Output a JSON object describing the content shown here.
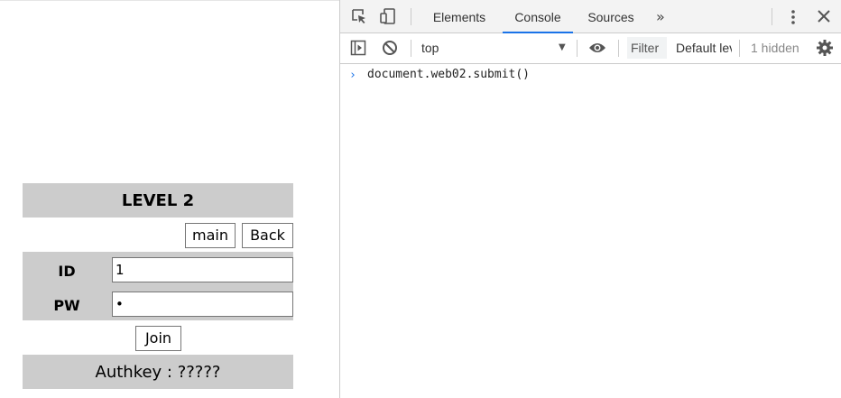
{
  "page": {
    "title": "LEVEL 2",
    "main_button": "main",
    "back_button": "Back",
    "id_label": "ID",
    "id_value": "1",
    "pw_label": "PW",
    "pw_value": "•",
    "join_button": "Join",
    "authkey_text": "Authkey : ?????",
    "panel_color": "#cccccc"
  },
  "devtools": {
    "tabs": {
      "elements": "Elements",
      "console": "Console",
      "sources": "Sources",
      "more": "»"
    },
    "active_tab": "Console",
    "active_tab_color": "#1a73e8",
    "toolbar": {
      "context": "top",
      "context_arrow": "▼",
      "filter_placeholder": "Filter",
      "levels": "Default levels",
      "hidden": "1 hidden"
    },
    "console": {
      "prompt": "›",
      "command": "document.web02.submit()"
    },
    "icons": [
      "inspect-icon",
      "device-toggle-icon",
      "more-tabs-icon",
      "kebab-menu-icon",
      "close-icon",
      "sidebar-toggle-icon",
      "clear-console-icon",
      "eye-icon",
      "settings-gear-icon"
    ]
  }
}
